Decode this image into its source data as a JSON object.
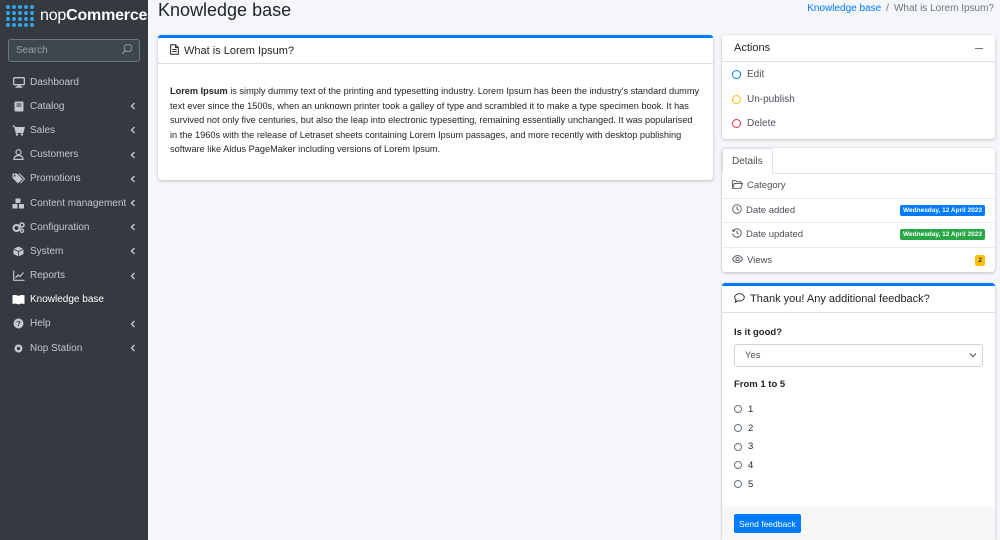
{
  "brand": {
    "name_light": "nop",
    "name_bold": "Commerce"
  },
  "sidebar": {
    "search_placeholder": "Search",
    "items": [
      {
        "label": "Dashboard",
        "icon": "monitor-icon",
        "has_children": false
      },
      {
        "label": "Catalog",
        "icon": "book-icon",
        "has_children": true
      },
      {
        "label": "Sales",
        "icon": "cart-icon",
        "has_children": true
      },
      {
        "label": "Customers",
        "icon": "user-icon",
        "has_children": true
      },
      {
        "label": "Promotions",
        "icon": "tags-icon",
        "has_children": true
      },
      {
        "label": "Content management",
        "icon": "cubes-icon",
        "has_children": true
      },
      {
        "label": "Configuration",
        "icon": "cogs-icon",
        "has_children": true
      },
      {
        "label": "System",
        "icon": "cube-icon",
        "has_children": true
      },
      {
        "label": "Reports",
        "icon": "chart-icon",
        "has_children": true
      },
      {
        "label": "Knowledge base",
        "icon": "open-book-icon",
        "has_children": false,
        "active": true
      },
      {
        "label": "Help",
        "icon": "question-icon",
        "has_children": true
      },
      {
        "label": "Nop Station",
        "icon": "nopstation-icon",
        "has_children": true
      }
    ]
  },
  "header": {
    "title": "Knowledge base",
    "breadcrumb": {
      "link": "Knowledge base",
      "separator": "/",
      "current": "What is Lorem Ipsum?"
    }
  },
  "article": {
    "title": "What is Lorem Ipsum?",
    "lead": "Lorem Ipsum",
    "body": " is simply dummy text of the printing and typesetting industry. Lorem Ipsum has been the industry's standard dummy text ever since the 1500s, when an unknown printer took a galley of type and scrambled it to make a type specimen book. It has survived not only five centuries, but also the leap into electronic typesetting, remaining essentially unchanged. It was popularised in the 1960s with the release of Letraset sheets containing Lorem Ipsum passages, and more recently with desktop publishing software like Aldus PageMaker including versions of Lorem Ipsum."
  },
  "actions": {
    "title": "Actions",
    "items": [
      {
        "label": "Edit",
        "color": "#007bff"
      },
      {
        "label": "Un-publish",
        "color": "#ffc107"
      },
      {
        "label": "Delete",
        "color": "#dc3545"
      }
    ]
  },
  "details": {
    "tab": "Details",
    "category_label": "Category",
    "date_added_label": "Date added",
    "date_added": "Wednesday, 12 April 2023",
    "date_updated_label": "Date updated",
    "date_updated": "Wednesday, 12 April 2023",
    "views_label": "Views",
    "views": "2"
  },
  "feedback": {
    "title": "Thank you! Any additional feedback?",
    "question1": "Is it good?",
    "question1_value": "Yes",
    "question2": "From 1 to 5",
    "options": [
      "1",
      "2",
      "3",
      "4",
      "5"
    ],
    "submit_label": "Send feedback"
  },
  "colors": {
    "sidebar_bg": "#343a40",
    "accent": "#007bff",
    "success": "#28a745",
    "warning": "#ffc107",
    "danger": "#dc3545"
  }
}
